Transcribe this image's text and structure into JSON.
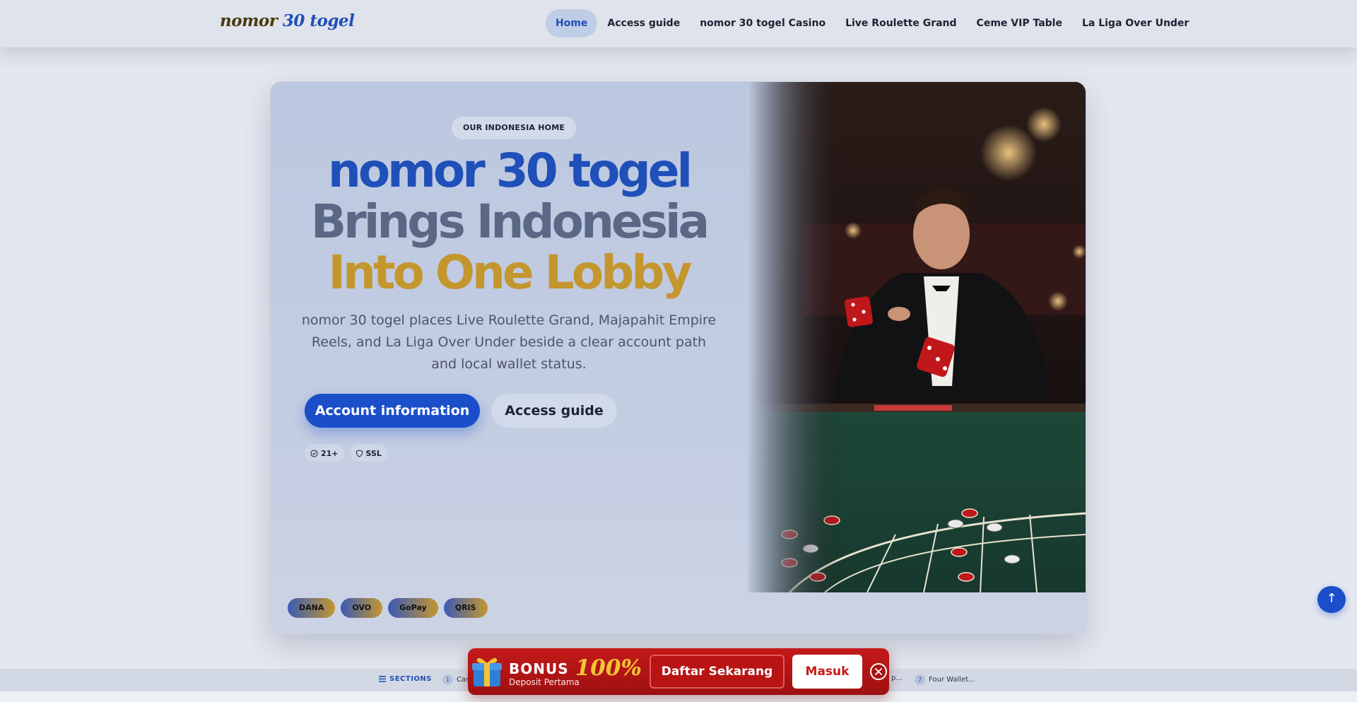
{
  "header": {
    "logo_word1": "nomor",
    "logo_word2": "30 togel",
    "nav": [
      {
        "label": "Home",
        "active": true
      },
      {
        "label": "Access guide"
      },
      {
        "label": "nomor 30 togel Casino"
      },
      {
        "label": "Live Roulette Grand"
      },
      {
        "label": "Ceme VIP Table"
      },
      {
        "label": "La Liga Over Under"
      }
    ]
  },
  "hero": {
    "eyebrow": "OUR INDONESIA HOME",
    "headline_line1": "nomor 30 togel",
    "headline_line2": "Brings Indonesia",
    "headline_line3": "Into One Lobby",
    "subtitle": "nomor 30 togel places Live Roulette Grand, Majapahit Empire Reels, and La Liga Over Under beside a clear account path and local wallet status.",
    "primary_button": "Account information",
    "secondary_button": "Access guide",
    "badges": [
      {
        "icon": "check-circle-icon",
        "label": "21+"
      },
      {
        "icon": "shield-icon",
        "label": "SSL"
      }
    ],
    "wallets": [
      "DANA",
      "OVO",
      "GoPay",
      "QRIS"
    ]
  },
  "scroll_top": {
    "icon": "arrow-up-icon",
    "label": "↑"
  },
  "sections_bar": {
    "label": "SECTIONS",
    "items": [
      {
        "num": "1",
        "label": "Cas"
      },
      {
        "num": "7",
        "label": "Four Wallet..."
      }
    ],
    "partial_text": "p..."
  },
  "bonus_banner": {
    "word": "BONUS",
    "percent": "100%",
    "subtext": "Deposit Pertama",
    "register_button": "Daftar Sekarang",
    "login_button": "Masuk"
  },
  "colors": {
    "primary_blue": "#1b4fc9",
    "gold": "#c4962e",
    "banner_red": "#c41a1a",
    "page_bg": "#e3e7ef"
  }
}
